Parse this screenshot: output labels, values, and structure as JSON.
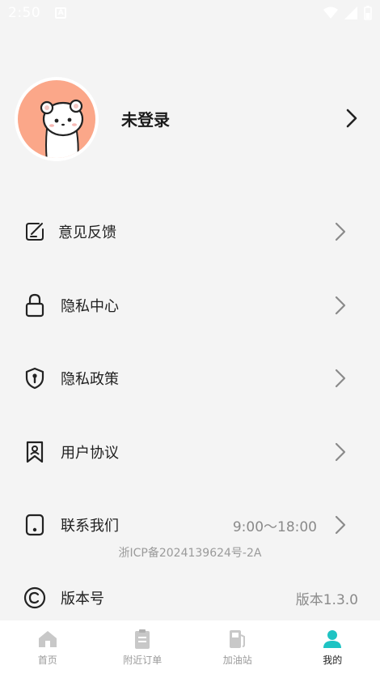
{
  "status_bar": {
    "time": "2:50",
    "notification_icon": "a-notification-icon"
  },
  "profile": {
    "name": "未登录",
    "avatar": "bear-avatar"
  },
  "menu": {
    "feedback": {
      "label": "意见反馈",
      "icon": "edit-note-icon"
    },
    "privacy_center": {
      "label": "隐私中心",
      "icon": "lock-icon"
    },
    "privacy_policy": {
      "label": "隐私政策",
      "icon": "shield-key-icon"
    },
    "user_agreement": {
      "label": "用户协议",
      "icon": "bookmark-user-icon"
    },
    "contact_us": {
      "label": "联系我们",
      "value": "9:00～18:00",
      "icon": "phone-icon"
    },
    "version": {
      "label": "版本号",
      "value": "版本1.3.0",
      "icon": "copyright-icon"
    }
  },
  "icp": "浙ICP备2024139624号-2A",
  "tabs": [
    {
      "label": "首页",
      "icon": "home-icon",
      "active": false
    },
    {
      "label": "附近订单",
      "icon": "clipboard-icon",
      "active": false
    },
    {
      "label": "加油站",
      "icon": "fuel-pump-icon",
      "active": false
    },
    {
      "label": "我的",
      "icon": "person-icon",
      "active": true
    }
  ],
  "colors": {
    "accent": "#1fc3c3",
    "background": "#f4f4f4",
    "avatar_bg": "#fba789",
    "inactive_tab": "#c8c8c8"
  }
}
